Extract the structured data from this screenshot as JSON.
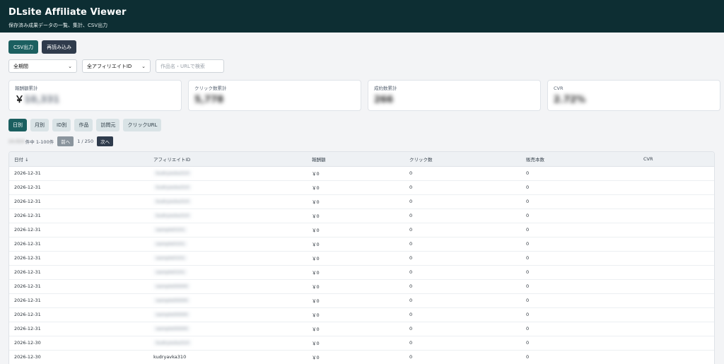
{
  "header": {
    "title": "DLsite Affiliate Viewer",
    "subtitle": "保存済み成果データの一覧、集計、CSV出力"
  },
  "toolbar": {
    "csv_label": "CSV出力",
    "reload_label": "再読み込み"
  },
  "filters": {
    "period": "全期間",
    "affiliate": "全アフィリエイトID",
    "search_placeholder": "作品名・URLで検索"
  },
  "cards": [
    {
      "label": "報酬額累計",
      "value": "￥10,331"
    },
    {
      "label": "クリック数累計",
      "value": "5,778"
    },
    {
      "label": "成約数累計",
      "value": "266"
    },
    {
      "label": "CVR",
      "value": "2.72%"
    }
  ],
  "tabs": [
    "日別",
    "月別",
    "ID別",
    "作品",
    "訪問元",
    "クリックURL"
  ],
  "pager": {
    "count_prefix": "24,924",
    "count_text": "件中 1-100件",
    "prev": "前へ",
    "page": "1 / 250",
    "next": "次へ"
  },
  "table": {
    "columns": [
      "日付 ↓",
      "アフィリエイトID",
      "報酬額",
      "クリック数",
      "販売本数",
      "CVR"
    ],
    "rows": [
      {
        "date": "2026-12-31",
        "id": "kudryavka310",
        "reward": "￥0",
        "clicks": "0",
        "sales": "0",
        "cvr": ""
      },
      {
        "date": "2026-12-31",
        "id": "kudryavka310",
        "reward": "￥0",
        "clicks": "0",
        "sales": "0",
        "cvr": ""
      },
      {
        "date": "2026-12-31",
        "id": "kudryavka310",
        "reward": "￥0",
        "clicks": "0",
        "sales": "0",
        "cvr": ""
      },
      {
        "date": "2026-12-31",
        "id": "kudryavka310",
        "reward": "￥0",
        "clicks": "0",
        "sales": "0",
        "cvr": ""
      },
      {
        "date": "2026-12-31",
        "id": "sample0101",
        "reward": "￥0",
        "clicks": "0",
        "sales": "0",
        "cvr": ""
      },
      {
        "date": "2026-12-31",
        "id": "sample0101",
        "reward": "￥0",
        "clicks": "0",
        "sales": "0",
        "cvr": ""
      },
      {
        "date": "2026-12-31",
        "id": "sample0101",
        "reward": "￥0",
        "clicks": "0",
        "sales": "0",
        "cvr": ""
      },
      {
        "date": "2026-12-31",
        "id": "sample0101",
        "reward": "￥0",
        "clicks": "0",
        "sales": "0",
        "cvr": ""
      },
      {
        "date": "2026-12-31",
        "id": "sample00000",
        "reward": "￥0",
        "clicks": "0",
        "sales": "0",
        "cvr": ""
      },
      {
        "date": "2026-12-31",
        "id": "sample00000",
        "reward": "￥0",
        "clicks": "0",
        "sales": "0",
        "cvr": ""
      },
      {
        "date": "2026-12-31",
        "id": "sample00000",
        "reward": "￥0",
        "clicks": "0",
        "sales": "0",
        "cvr": ""
      },
      {
        "date": "2026-12-31",
        "id": "sample00000",
        "reward": "￥0",
        "clicks": "0",
        "sales": "0",
        "cvr": ""
      },
      {
        "date": "2026-12-30",
        "id": "kudryavka310",
        "reward": "￥0",
        "clicks": "0",
        "sales": "0",
        "cvr": ""
      },
      {
        "date": "2026-12-30",
        "id": "kudryavka310",
        "reward": "￥0",
        "clicks": "0",
        "sales": "0",
        "cvr": ""
      }
    ]
  },
  "colors": {
    "header_bg": "#0d2e33",
    "accent": "#1b5f60",
    "dark_button": "#2f3b4c"
  }
}
